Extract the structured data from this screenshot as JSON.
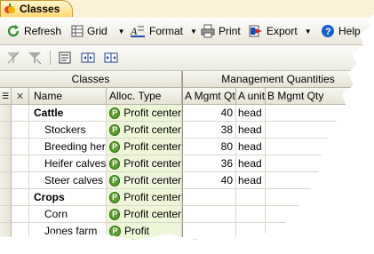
{
  "window": {
    "tab_title": "Classes"
  },
  "toolbar": {
    "refresh": "Refresh",
    "grid": "Grid",
    "format": "Format",
    "print": "Print",
    "export": "Export",
    "help": "Help"
  },
  "grid": {
    "group_headers": {
      "classes": "Classes",
      "mgmt": "Management Quantities"
    },
    "columns": {
      "name": "Name",
      "alloc": "Alloc. Type",
      "aqty": "A Mgmt Qty",
      "aunit": "A unit",
      "bqty": "B Mgmt Qty"
    },
    "rows": [
      {
        "name": "Cattle",
        "alloc": "Profit center",
        "aqty": "40",
        "aunit": "head",
        "group": true
      },
      {
        "name": "Stockers",
        "alloc": "Profit center",
        "aqty": "38",
        "aunit": "head",
        "group": false
      },
      {
        "name": "Breeding herd",
        "alloc": "Profit center",
        "aqty": "80",
        "aunit": "head",
        "group": false
      },
      {
        "name": "Heifer calves",
        "alloc": "Profit center",
        "aqty": "36",
        "aunit": "head",
        "group": false
      },
      {
        "name": "Steer calves",
        "alloc": "Profit center",
        "aqty": "40",
        "aunit": "head",
        "group": false
      },
      {
        "name": "Crops",
        "alloc": "Profit center",
        "aqty": "",
        "aunit": "",
        "group": true
      },
      {
        "name": "Corn",
        "alloc": "Profit center",
        "aqty": "",
        "aunit": "",
        "group": false
      },
      {
        "name": "Jones farm",
        "alloc": "Profit",
        "aqty": "",
        "aunit": "",
        "group": false
      }
    ]
  },
  "colors": {
    "accent": "#ffd874",
    "badge": "#5aa02c",
    "alloc_fill": "#eef6da"
  }
}
